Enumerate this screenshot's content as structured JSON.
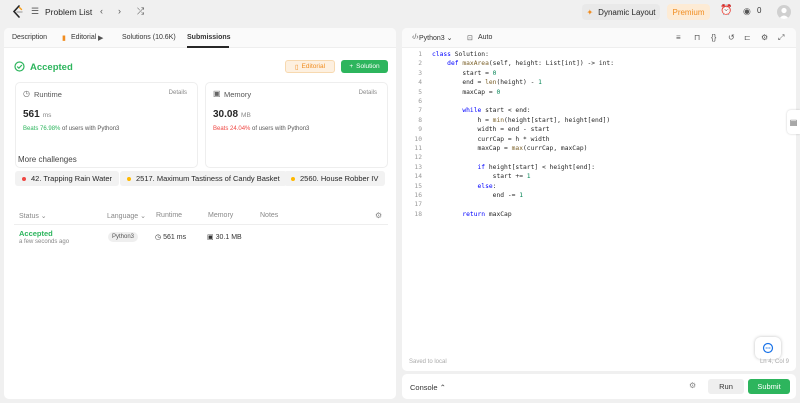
{
  "topbar": {
    "title": "Problem List",
    "dynamic_layout": "Dynamic Layout",
    "premium": "Premium",
    "streak_count": "0"
  },
  "left_tabs": [
    {
      "label": "Description"
    },
    {
      "label": "Editorial"
    },
    {
      "label": "Solutions (10.6K)"
    },
    {
      "label": "Submissions"
    }
  ],
  "result": {
    "status": "Accepted",
    "editorial_btn": "Editorial",
    "solution_btn": "Solution"
  },
  "runtime": {
    "label": "Runtime",
    "details": "Details",
    "value": "561",
    "unit": "ms",
    "beats_pct": "Beats 76.98%",
    "beats_rest": "of users with Python3"
  },
  "memory": {
    "label": "Memory",
    "details": "Details",
    "value": "30.08",
    "unit": "MB",
    "beats_pct": "Beats 24.04%",
    "beats_rest": "of users with Python3"
  },
  "more_challenges": {
    "title": "More challenges",
    "items": [
      {
        "label": "42. Trapping Rain Water",
        "color": "#ef4743"
      },
      {
        "label": "2517. Maximum Tastiness of Candy Basket",
        "color": "#ffb800"
      },
      {
        "label": "2560. House Robber IV",
        "color": "#ffb800"
      }
    ]
  },
  "submissions_table": {
    "headers": {
      "status": "Status",
      "language": "Language",
      "runtime": "Runtime",
      "memory": "Memory",
      "notes": "Notes"
    },
    "rows": [
      {
        "status": "Accepted",
        "time": "a few seconds ago",
        "language": "Python3",
        "runtime": "561 ms",
        "memory": "30.1 MB"
      }
    ]
  },
  "editor": {
    "language": "Python3",
    "auto": "Auto",
    "saved": "Saved to local",
    "cursor": "Ln 4, Col 9"
  },
  "code_lines": [
    "class Solution:",
    "    def maxArea(self, height: List[int]) -> int:",
    "        start = 0",
    "        end = len(height) - 1",
    "        maxCap = 0",
    "",
    "        while start < end:",
    "            h = min(height[start], height[end])",
    "            width = end - start",
    "            currCap = h * width",
    "            maxCap = max(currCap, maxCap)",
    "",
    "            if height[start] < height[end]:",
    "                start += 1",
    "            else:",
    "                end -= 1",
    "",
    "        return maxCap"
  ],
  "console": {
    "label": "Console",
    "run": "Run",
    "submit": "Submit"
  }
}
